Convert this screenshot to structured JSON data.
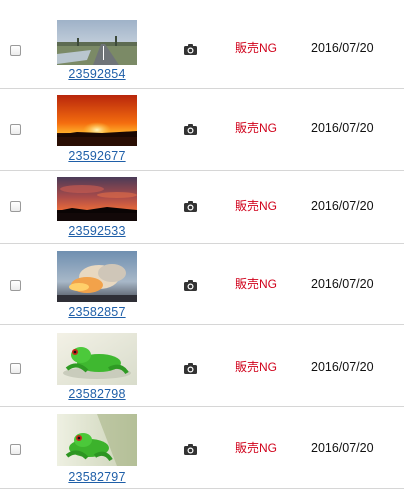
{
  "rows": [
    {
      "image_id": "23592854",
      "thumbnail": "road-flood-photo",
      "media_icon": "camera-icon",
      "status": "販売NG",
      "date": "2016/07/20"
    },
    {
      "image_id": "23592677",
      "thumbnail": "orange-sunset-photo",
      "media_icon": "camera-icon",
      "status": "販売NG",
      "date": "2016/07/20"
    },
    {
      "image_id": "23592533",
      "thumbnail": "red-sky-dusk-photo",
      "media_icon": "camera-icon",
      "status": "販売NG",
      "date": "2016/07/20"
    },
    {
      "image_id": "23582857",
      "thumbnail": "cloud-sunset-photo",
      "media_icon": "camera-icon",
      "status": "販売NG",
      "date": "2016/07/20"
    },
    {
      "image_id": "23582798",
      "thumbnail": "green-frog-photo",
      "media_icon": "camera-icon",
      "status": "販売NG",
      "date": "2016/07/20"
    },
    {
      "image_id": "23582797",
      "thumbnail": "green-frog-photo",
      "media_icon": "camera-icon",
      "status": "販売NG",
      "date": "2016/07/20"
    }
  ],
  "colors": {
    "status": "#d0021b",
    "link": "#1f5fa8",
    "divider": "#d6d6d6"
  }
}
